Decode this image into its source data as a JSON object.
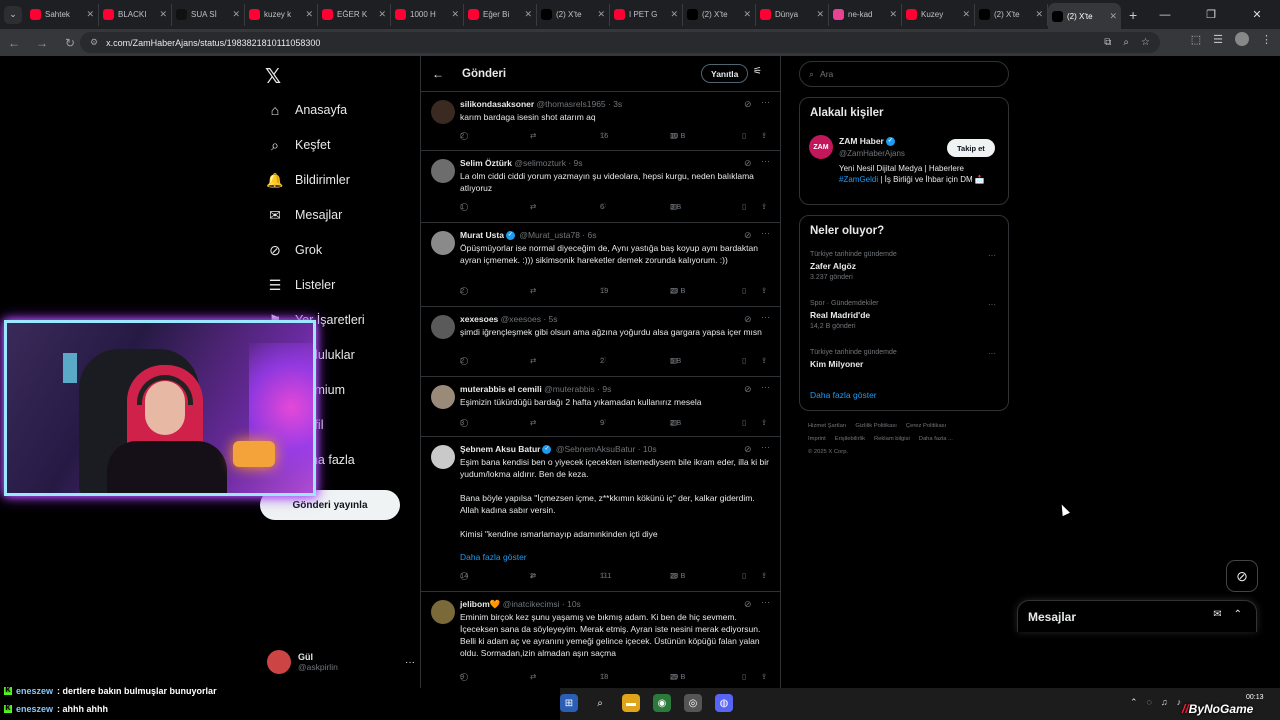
{
  "browser": {
    "tabs": [
      {
        "label": "Sahtek",
        "color": "#ff0033"
      },
      {
        "label": "BLACKI",
        "color": "#ff0033"
      },
      {
        "label": "SUA Sİ",
        "color": "#111111"
      },
      {
        "label": "kuzey k",
        "color": "#ff0033"
      },
      {
        "label": "EĞER K",
        "color": "#ff0033"
      },
      {
        "label": "1000 H",
        "color": "#ff0033"
      },
      {
        "label": "Eğer Bi",
        "color": "#ff0033"
      },
      {
        "label": "(2) X'te",
        "color": "#000000"
      },
      {
        "label": "I PET G",
        "color": "#ff0033"
      },
      {
        "label": "(2) X'te",
        "color": "#000000"
      },
      {
        "label": "Dünya",
        "color": "#ff0033"
      },
      {
        "label": "ne-kad",
        "color": "#e84393"
      },
      {
        "label": "Kuzey",
        "color": "#ff0033"
      },
      {
        "label": "(2) X'te",
        "color": "#000000"
      },
      {
        "label": "(2) X'te",
        "color": "#000000"
      }
    ],
    "url": "x.com/ZamHaberAjans/status/1983821810111058300"
  },
  "nav": {
    "items": [
      {
        "label": "Anasayfa",
        "icon": "home-icon"
      },
      {
        "label": "Keşfet",
        "icon": "search-icon"
      },
      {
        "label": "Bildirimler",
        "icon": "bell-icon"
      },
      {
        "label": "Mesajlar",
        "icon": "mail-icon"
      },
      {
        "label": "Grok",
        "icon": "grok-icon"
      },
      {
        "label": "Listeler",
        "icon": "list-icon"
      },
      {
        "label": "Yer İşaretleri",
        "icon": "bookmark-icon"
      },
      {
        "label": "Topluluklar",
        "icon": "community-icon"
      },
      {
        "label": "Premium",
        "icon": "premium-icon"
      },
      {
        "label": "Profil",
        "icon": "profile-icon"
      },
      {
        "label": "Daha fazla",
        "icon": "more-icon"
      }
    ],
    "post_button": "Gönderi yayınla",
    "user": {
      "name": "Gül",
      "handle": "@askpirlin"
    }
  },
  "main": {
    "title": "Gönderi",
    "reply_button": "Yanıtla",
    "tweets": [
      {
        "name": "silikondasaksoner",
        "handle": "@thomasrels1965 · 3s",
        "verified": false,
        "text": "karım bardaga isesin shot atarım aq",
        "replies": "2",
        "retweets": "",
        "likes": "16",
        "views": "10 B",
        "avatar": "#3a2a22"
      },
      {
        "name": "Selim Öztürk",
        "handle": "@selimozturk · 9s",
        "verified": false,
        "text": "La olm ciddi ciddi yorum yazmayın şu videolara, hepsi kurgu, neden balıklama atlıyoruz",
        "replies": "1",
        "retweets": "",
        "likes": "6",
        "views": "3 B",
        "avatar": "#6d6d6d"
      },
      {
        "name": "Murat Usta",
        "handle": "@Murat_usta78 · 6s",
        "verified": true,
        "text": "Öpüşmüyorlar ise normal diyeceğim de, Aynı yastığa baş koyup aynı bardaktan ayran içmemek. :))) sikimsonik hareketler demek zorunda kalıyorum. :))",
        "replies": "2",
        "retweets": "",
        "likes": "19",
        "views": "23 B",
        "avatar": "#8a8a8a"
      },
      {
        "name": "xexesoes",
        "handle": "@xeesoes · 5s",
        "verified": false,
        "text": "şimdi iğrençleşmek gibi olsun ama ağzına yoğurdu alsa gargara yapsa içer mısn",
        "replies": "2",
        "retweets": "",
        "likes": "2",
        "views": "5 B",
        "avatar": "#5a5a5a"
      },
      {
        "name": "muterabbis el cemili",
        "handle": "@muterabbis · 9s",
        "verified": false,
        "text": "Eşimizin tükürdüğü bardağı 2 hafta yıkamadan kullanırız mesela",
        "replies": "3",
        "retweets": "",
        "likes": "9",
        "views": "2 B",
        "avatar": "#9a8a7a"
      },
      {
        "name": "Şebnem Aksu Batur",
        "handle": "@SebnemAksuBatur · 10s",
        "verified": true,
        "text": "Eşim bana kendisi ben o yiyecek içecekten istemediysem bile ikram eder, illa ki bir yudum/lokma aldırır. Ben de keza.\n\nBana böyle yapılsa \"İçmezsen içme, z**kkımın kökünü iç\" der, kalkar giderdim.\nAllah kadına sabır versin.\n\nKimisi \"kendine ısmarlamayıp adamınkinden içti diye",
        "show_more": "Daha fazla göster",
        "replies": "14",
        "retweets": "2",
        "likes": "111",
        "views": "28 B",
        "avatar": "#c9c9c9"
      },
      {
        "name": "jelibom",
        "handle": "@inatcikecimsi · 10s",
        "verified": false,
        "emoji": "🧡",
        "text": "Eminim birçok kez şunu yaşamış ve bıkmış adam. Ki ben de hiç sevmem. İçeceksen sana da söyleyeyim. Merak etmiş. Ayran iste nesini merak ediyorsun. Belli ki adam aç ve ayranını yemeği gelince içecek. Üstünün köpüğü falan yalan oldu. Sormadan,izin almadan aşın saçma",
        "replies": "9",
        "retweets": "",
        "likes": "18",
        "views": "29 B",
        "avatar": "#7a6a3a"
      }
    ]
  },
  "right": {
    "search_placeholder": "Ara",
    "related": {
      "title": "Alakalı kişiler",
      "name": "ZAM Haber",
      "handle": "@ZamHaberAjans",
      "follow": "Takip et",
      "bio_start": "Yeni Nesil Dijital Medya | Haberlere",
      "bio_hashtag": "#ZamGeldi",
      "bio_end": " | İş Birliği ve İhbar için DM 📩",
      "logo": "ZAM"
    },
    "trends": {
      "title": "Neler oluyor?",
      "items": [
        {
          "category": "Türkiye tarihinde gündemde",
          "name": "Zafer Algöz",
          "count": "3.237 gönderi"
        },
        {
          "category": "Spor · Gündemdekiler",
          "name": "Real Madrid'de",
          "count": "14,2 B gönderi"
        },
        {
          "category": "Türkiye tarihinde gündemde",
          "name": "Kim Milyoner",
          "count": ""
        }
      ],
      "show_more": "Daha fazla göster"
    },
    "footer": [
      "Hizmet Şartları",
      "Gizlilik Politikası",
      "Çerez Politikası",
      "Imprint",
      "Erişilebilirlik",
      "Reklam bilgisi",
      "Daha fazla ...",
      "© 2025 X Corp."
    ]
  },
  "messages_drawer": {
    "title": "Mesajlar"
  },
  "chat": [
    {
      "user": "eneszew",
      "text": ": dertlere bakın bulmuşlar bunuyorlar"
    },
    {
      "user": "eneszew",
      "text": ": ahhh ahhh"
    }
  ],
  "clock": {
    "time": "00:13"
  },
  "watermark": {
    "text": "ByNoGame"
  }
}
